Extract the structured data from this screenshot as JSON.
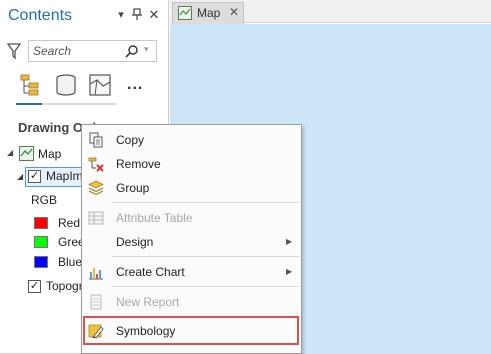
{
  "contents_pane": {
    "title": "Contents",
    "search_placeholder": "Search",
    "more_label": "...",
    "section_heading": "Drawing Order",
    "tree": {
      "map": "Map",
      "layer": "MapImageLayer",
      "rgb_label": "RGB",
      "channels": [
        {
          "label": "Red:",
          "color": "#ff0000"
        },
        {
          "label": "Green",
          "color": "#00ff00"
        },
        {
          "label": "Blue",
          "color": "#0000ff"
        }
      ],
      "basemap": "Topographic"
    }
  },
  "map_tab": {
    "label": "Map",
    "close": "✕"
  },
  "context_menu": {
    "copy": "Copy",
    "remove": "Remove",
    "group": "Group",
    "attribute_table": "Attribute Table",
    "design": "Design",
    "create_chart": "Create Chart",
    "new_report": "New Report",
    "symbology": "Symbology"
  },
  "colors": {
    "accent": "#2a6db5",
    "map_background": "#cce6f8",
    "highlight": "#d9534f"
  }
}
